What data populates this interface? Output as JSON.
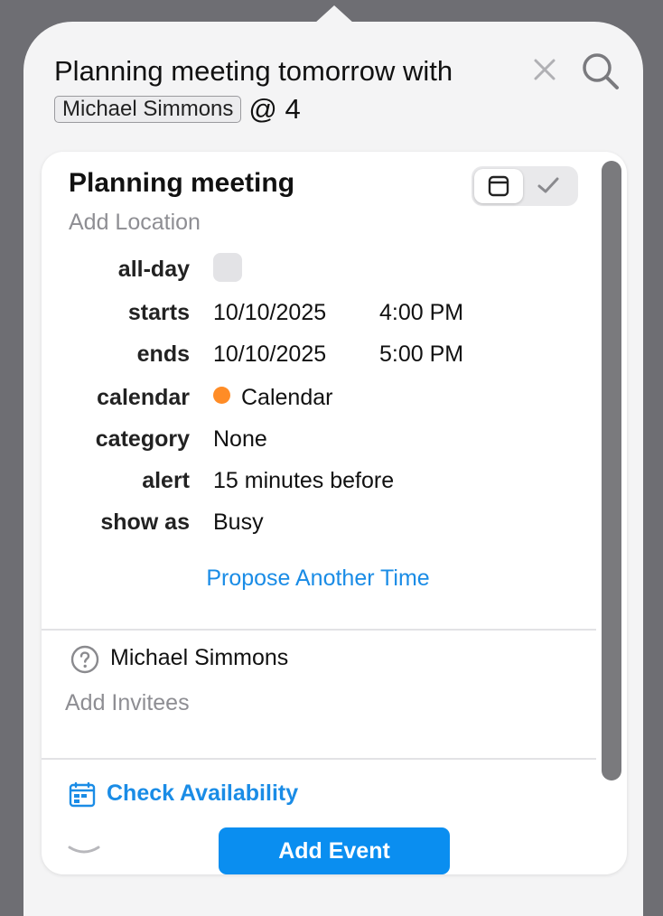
{
  "query": {
    "prefix": "Planning meeting tomorrow with",
    "token": "Michael Simmons",
    "suffix": "@ 4"
  },
  "event": {
    "title": "Planning meeting",
    "location_placeholder": "Add Location",
    "rows": {
      "allday_label": "all-day",
      "starts_label": "starts",
      "starts_date": "10/10/2025",
      "starts_time": "4:00 PM",
      "ends_label": "ends",
      "ends_date": "10/10/2025",
      "ends_time": "5:00 PM",
      "calendar_label": "calendar",
      "calendar_value": "Calendar",
      "category_label": "category",
      "category_value": "None",
      "alert_label": "alert",
      "alert_value": "15 minutes before",
      "showas_label": "show as",
      "showas_value": "Busy"
    },
    "propose_label": "Propose Another Time"
  },
  "invitees": {
    "items": [
      {
        "name": "Michael Simmons",
        "status_icon": "question-circle-icon"
      }
    ],
    "add_placeholder": "Add Invitees"
  },
  "actions": {
    "check_availability": "Check Availability",
    "add_event": "Add Event"
  },
  "icons": {
    "close": "close-icon",
    "search": "search-icon",
    "event_mode": "calendar-icon",
    "reminder_mode": "checkmark-icon",
    "availability": "calendar-grid-icon",
    "collapse": "chevron-down-icon"
  },
  "colors": {
    "accent": "#0a8ef0",
    "link": "#1a8ce6",
    "calendar_dot": "#ff8c26",
    "placeholder": "#8e8e93"
  }
}
